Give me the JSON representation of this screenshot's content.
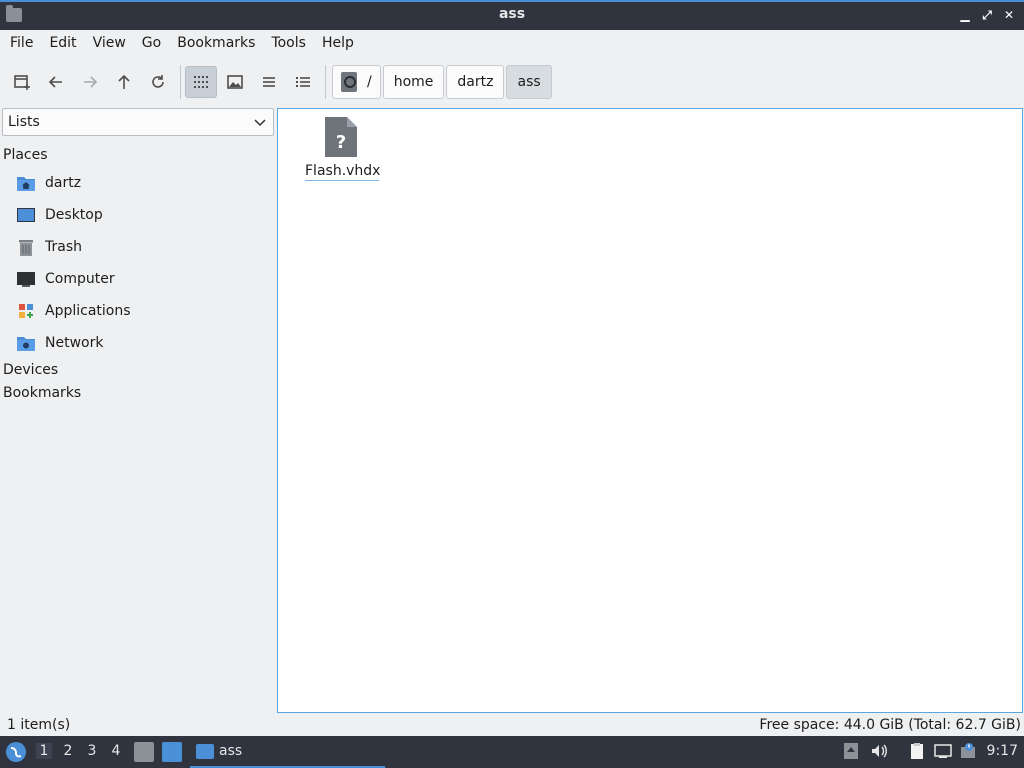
{
  "window": {
    "title": "ass",
    "minimize_glyph": "▁",
    "maximize_glyph": "⤢",
    "close_glyph": "✕"
  },
  "menubar": {
    "items": [
      "File",
      "Edit",
      "View",
      "Go",
      "Bookmarks",
      "Tools",
      "Help"
    ]
  },
  "pathbar": {
    "root": "/",
    "crumbs": [
      "home",
      "dartz",
      "ass"
    ]
  },
  "sidebar": {
    "lists_select": "Lists",
    "places_header": "Places",
    "places": [
      "dartz",
      "Desktop",
      "Trash",
      "Computer",
      "Applications",
      "Network"
    ],
    "devices_header": "Devices",
    "bookmarks_header": "Bookmarks"
  },
  "files": [
    {
      "name": "Flash.vhdx",
      "icon": "unknown-file-icon"
    }
  ],
  "statusbar": {
    "count": "1 item(s)",
    "free_space": "Free space: 44.0 GiB (Total: 62.7 GiB)"
  },
  "taskbar": {
    "desktops": [
      "1",
      "2",
      "3",
      "4"
    ],
    "task_label": "ass",
    "clock": "9:17"
  },
  "colors": {
    "accent": "#4a8fd8",
    "titlebar": "#2f343f",
    "selection_border": "#5aa6e0"
  }
}
